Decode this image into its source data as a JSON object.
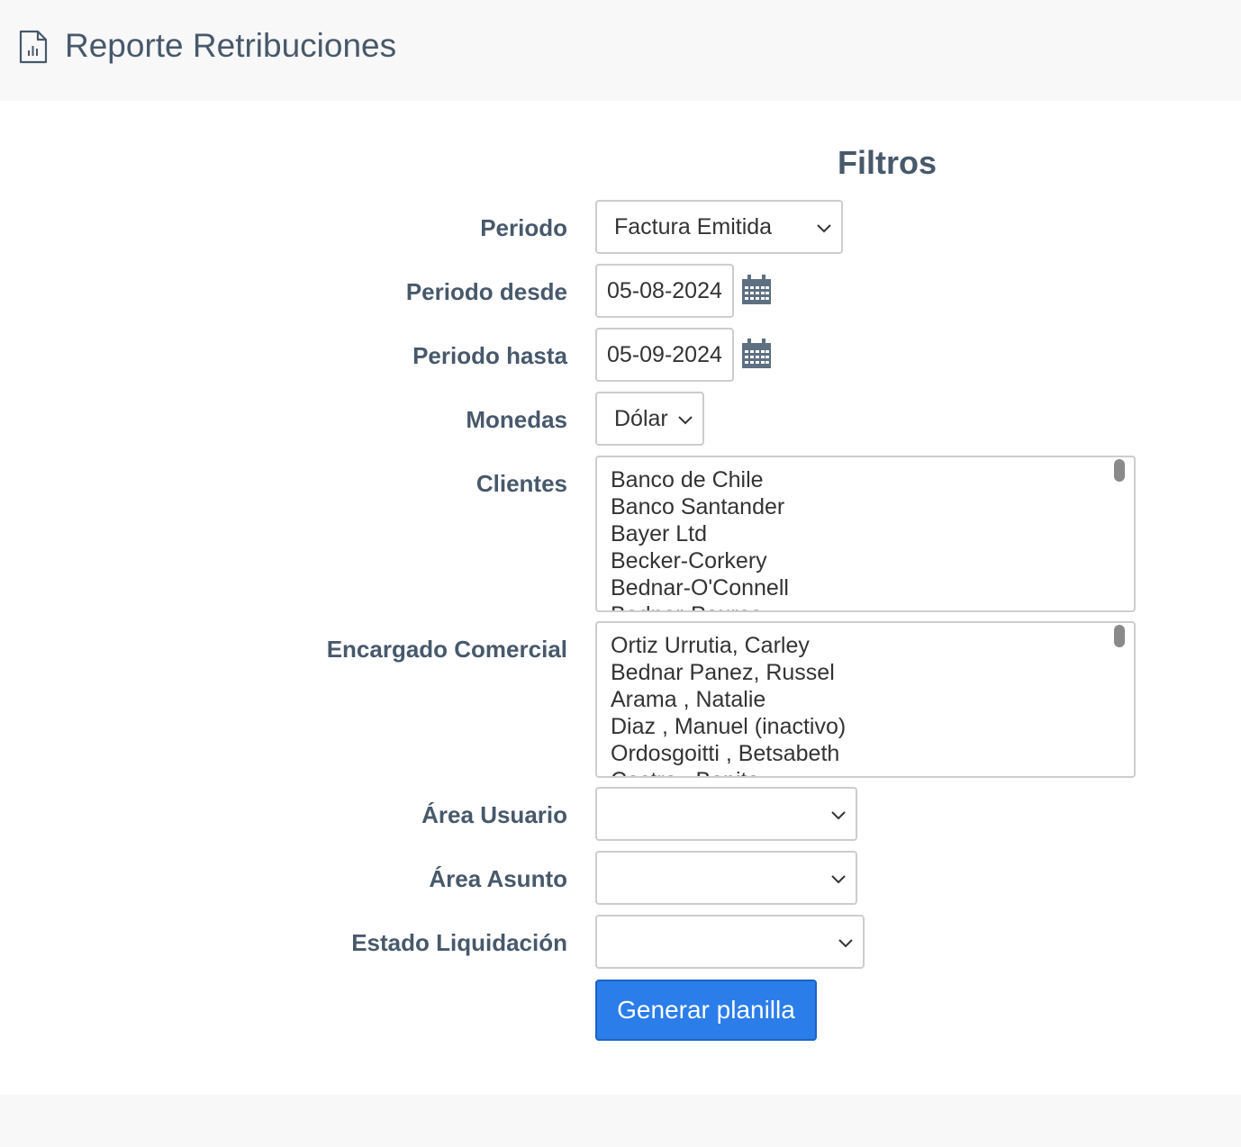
{
  "header": {
    "title": "Reporte Retribuciones",
    "icon": "report-document-icon"
  },
  "filters": {
    "heading": "Filtros",
    "periodo": {
      "label": "Periodo",
      "value": "Factura Emitida"
    },
    "periodo_desde": {
      "label": "Periodo desde",
      "value": "05-08-2024"
    },
    "periodo_hasta": {
      "label": "Periodo hasta",
      "value": "05-09-2024"
    },
    "monedas": {
      "label": "Monedas",
      "value": "Dólar"
    },
    "clientes": {
      "label": "Clientes",
      "items": [
        "Banco de Chile",
        "Banco Santander",
        "Bayer Ltd",
        "Becker-Corkery",
        "Bednar-O'Connell",
        "Bednar-Pouros"
      ]
    },
    "encargado_comercial": {
      "label": "Encargado Comercial",
      "items": [
        "Ortiz Urrutia, Carley",
        "Bednar Panez, Russel",
        "Arama , Natalie",
        "Diaz , Manuel (inactivo)",
        "Ordosgoitti , Betsabeth",
        "Castro , Benito"
      ]
    },
    "area_usuario": {
      "label": "Área Usuario",
      "value": ""
    },
    "area_asunto": {
      "label": "Área Asunto",
      "value": ""
    },
    "estado_liquidacion": {
      "label": "Estado Liquidación",
      "value": ""
    },
    "submit_label": "Generar planilla"
  },
  "colors": {
    "text": "#47596b",
    "button": "#2b7de9",
    "page_bg": "#f8f8f8",
    "panel_bg": "#ffffff",
    "border": "#cdcdcd"
  }
}
